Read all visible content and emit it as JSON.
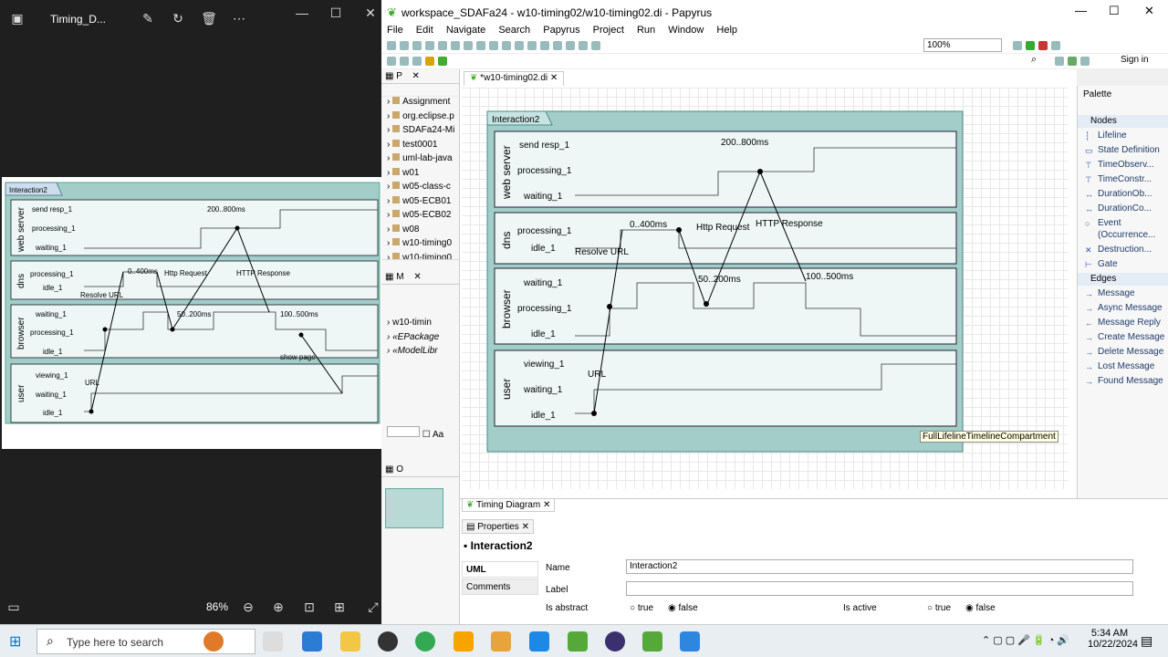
{
  "viewer": {
    "title": "Timing_D...",
    "zoom": "86%"
  },
  "thumb": {
    "frame_title": "Interaction2",
    "lifelines": [
      {
        "name": "web server",
        "states": [
          "send resp_1",
          "processing_1",
          "waiting_1"
        ]
      },
      {
        "name": "dns",
        "states": [
          "processing_1",
          "idle_1"
        ]
      },
      {
        "name": "browser",
        "states": [
          "waiting_1",
          "processing_1",
          "idle_1"
        ]
      },
      {
        "name": "user",
        "states": [
          "viewing_1",
          "waiting_1",
          "idle_1"
        ]
      }
    ],
    "labels": {
      "d1": "200..800ms",
      "d2": "0..400ms",
      "d3": "50..200ms",
      "d4": "100..500ms",
      "m1": "Http Request",
      "m2": "HTTP Response",
      "m3": "Resolve URL",
      "m4": "URL",
      "m5": "show page"
    }
  },
  "papyrus": {
    "title": "workspace_SDAFa24 - w10-timing02/w10-timing02.di - Papyrus",
    "menu": [
      "File",
      "Edit",
      "Navigate",
      "Search",
      "Papyrus",
      "Project",
      "Run",
      "Window",
      "Help"
    ],
    "zoom": "100%",
    "sign_in": "Sign in",
    "explorer_tab": "P",
    "projects": [
      "Assignment",
      "org.eclipse.p",
      "SDAFa24-Mi",
      "test0001",
      "uml-lab-java",
      "w01",
      "w05-class-c",
      "w05-ECB01",
      "w05-ECB02",
      "w08",
      "w10-timing0",
      "w10-timing0"
    ],
    "model_tab": "M",
    "model_items": [
      "w10-timin",
      "«EPackage",
      "«ModelLibr"
    ],
    "outline_tab": "O",
    "aa_label": "Aa",
    "editor_tab": "*w10-timing02.di",
    "diagram_tab": "Timing Diagram",
    "tooltip": "FullLifelineTimelineCompartment",
    "diagram": {
      "frame_title": "Interaction2",
      "lifelines": [
        {
          "name": "web server",
          "states": [
            "send resp_1",
            "processing_1",
            "waiting_1"
          ]
        },
        {
          "name": "dns",
          "states": [
            "processing_1",
            "idle_1"
          ]
        },
        {
          "name": "browser",
          "states": [
            "waiting_1",
            "processing_1",
            "idle_1"
          ]
        },
        {
          "name": "user",
          "states": [
            "viewing_1",
            "waiting_1",
            "idle_1"
          ]
        }
      ],
      "labels": {
        "d1": "200..800ms",
        "d2": "0..400ms",
        "d3": "50..200ms",
        "d4": "100..500ms",
        "m1": "Http Request",
        "m2": "HTTP Response",
        "m3": "Resolve URL",
        "m4": "URL"
      }
    },
    "palette": {
      "title": "Palette",
      "nodes_header": "Nodes",
      "nodes": [
        "Lifeline",
        "State Definition",
        "TimeObserv...",
        "TimeConstr...",
        "DurationOb...",
        "DurationCo...",
        "Event (Occurrence...",
        "Destruction...",
        "Gate"
      ],
      "edges_header": "Edges",
      "edges": [
        "Message",
        "Async Message",
        "Message Reply",
        "Create Message",
        "Delete Message",
        "Lost Message",
        "Found Message"
      ]
    },
    "properties": {
      "tab": "Properties",
      "element": "Interaction2",
      "sections": [
        "UML",
        "Comments"
      ],
      "name_label": "Name",
      "name_value": "Interaction2",
      "label_label": "Label",
      "label_value": "",
      "is_abstract": "Is abstract",
      "is_active": "Is active",
      "true_label": "true",
      "false_label": "false"
    }
  },
  "taskbar": {
    "search_placeholder": "Type here to search",
    "time": "5:34 AM",
    "date": "10/22/2024"
  }
}
